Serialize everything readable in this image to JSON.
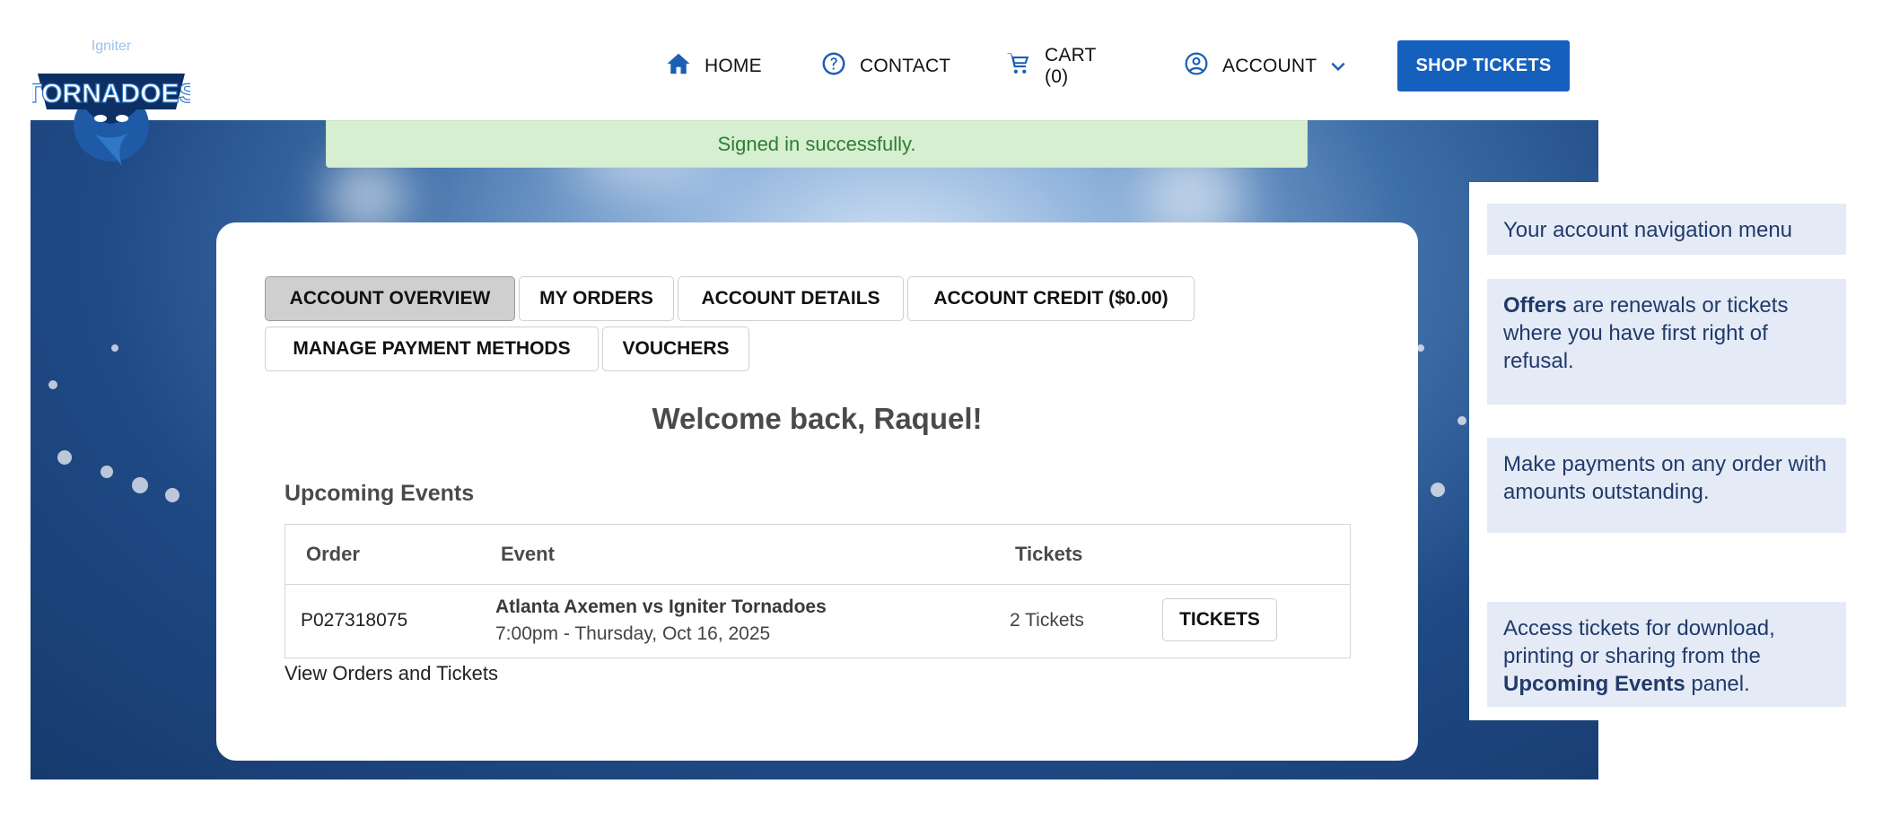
{
  "brand": {
    "small": "Igniter",
    "name": "TORNADOES"
  },
  "nav": {
    "home": "HOME",
    "contact": "CONTACT",
    "cart": "CART (0)",
    "account": "ACCOUNT",
    "shop": "SHOP TICKETS"
  },
  "alert": "Signed in successfully.",
  "tabs": {
    "overview": "ACCOUNT OVERVIEW",
    "orders": "MY ORDERS",
    "details": "ACCOUNT DETAILS",
    "credit": "ACCOUNT CREDIT ($0.00)",
    "payment": "MANAGE PAYMENT METHODS",
    "vouchers": "VOUCHERS"
  },
  "welcome": "Welcome back, Raquel!",
  "upcoming": {
    "title": "Upcoming Events",
    "headers": {
      "order": "Order",
      "event": "Event",
      "tickets": "Tickets"
    },
    "rows": [
      {
        "order": "P027318075",
        "event": "Atlanta Axemen vs Igniter Tornadoes",
        "datetime": "7:00pm - Thursday, Oct 16, 2025",
        "tickets": "2 Tickets",
        "button": "TICKETS"
      }
    ],
    "view_link": "View Orders and Tickets"
  },
  "help": {
    "tip1": "Your account navigation menu",
    "tip2_bold": "Offers",
    "tip2_rest": " are renewals or tickets where you have first right of refusal.",
    "tip3": "Make payments on any order with amounts outstanding.",
    "tip4_pre": "Access tickets for download, printing or sharing from the ",
    "tip4_bold": "Upcoming Events",
    "tip4_post": " panel."
  },
  "colors": {
    "accent": "#1560bd",
    "alert_bg": "#d6efd1",
    "tip_bg": "#e4ebf6"
  },
  "icons": [
    "home-icon",
    "help-icon",
    "cart-icon",
    "account-icon",
    "chevron-down-icon"
  ]
}
